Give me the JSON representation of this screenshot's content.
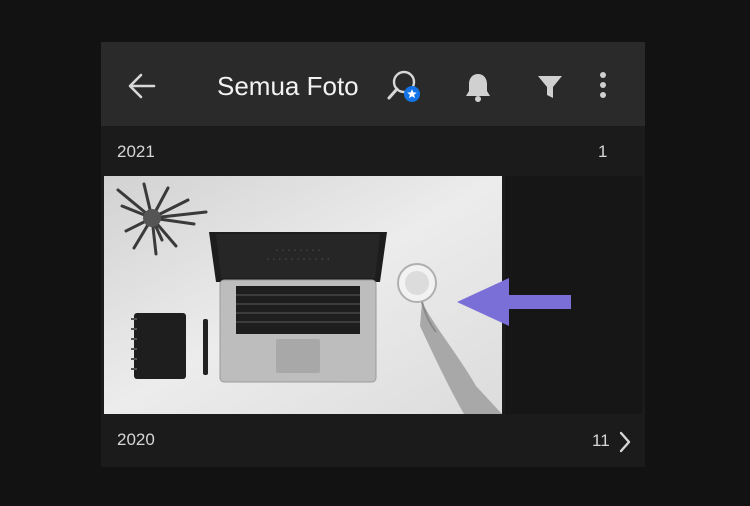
{
  "header": {
    "title": "Semua Foto",
    "icons": [
      "back-arrow-icon",
      "people-search-icon",
      "bell-icon",
      "filter-icon",
      "more-vertical-icon"
    ]
  },
  "sections": [
    {
      "year": "2021",
      "count": "1"
    },
    {
      "year": "2020",
      "count": "11"
    }
  ],
  "colors": {
    "background": "#121212",
    "appbar": "#2a2a2a",
    "badge": "#1473e6",
    "annotation_arrow": "#7a6fd6"
  }
}
